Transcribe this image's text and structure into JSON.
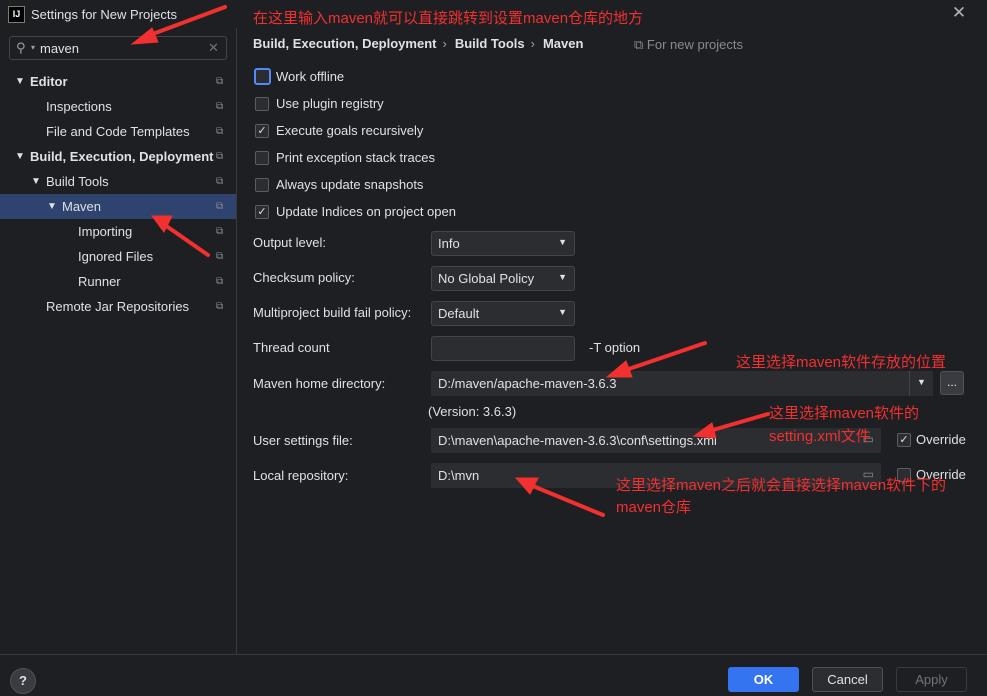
{
  "window": {
    "title": "Settings for New Projects",
    "logo": "IJ",
    "close_icon": "close-icon"
  },
  "search": {
    "value": "maven",
    "placeholder": ""
  },
  "sidebar": {
    "items": [
      {
        "label": "Editor",
        "expanded": true,
        "bold": true
      },
      {
        "label": "Inspections"
      },
      {
        "label": "File and Code Templates"
      },
      {
        "label": "Build, Execution, Deployment",
        "expanded": true,
        "bold": true
      },
      {
        "label": "Build Tools",
        "expanded": true
      },
      {
        "label": "Maven",
        "expanded": true,
        "selected": true
      },
      {
        "label": "Importing"
      },
      {
        "label": "Ignored Files"
      },
      {
        "label": "Runner"
      },
      {
        "label": "Remote Jar Repositories"
      }
    ]
  },
  "breadcrumb": {
    "items": [
      "Build, Execution, Deployment",
      "Build Tools",
      "Maven"
    ],
    "sep": "›",
    "scope": "For new projects"
  },
  "checkboxes": [
    {
      "label": "Work offline",
      "checked": false
    },
    {
      "label": "Use plugin registry",
      "checked": false
    },
    {
      "label": "Execute goals recursively",
      "checked": true
    },
    {
      "label": "Print exception stack traces",
      "checked": false
    },
    {
      "label": "Always update snapshots",
      "checked": false
    },
    {
      "label": "Update Indices on project open",
      "checked": true
    }
  ],
  "form": {
    "output_level": {
      "label": "Output level:",
      "value": "Info"
    },
    "checksum_policy": {
      "label": "Checksum policy:",
      "value": "No Global Policy"
    },
    "fail_policy": {
      "label": "Multiproject build fail policy:",
      "value": "Default"
    },
    "thread_count": {
      "label": "Thread count",
      "value": "",
      "hint": "-T option"
    },
    "maven_home": {
      "label": "Maven home directory:",
      "value": "D:/maven/apache-maven-3.6.3",
      "version": "(Version: 3.6.3)",
      "browse": "..."
    },
    "user_settings": {
      "label": "User settings file:",
      "value": "D:\\maven\\apache-maven-3.6.3\\conf\\settings.xml",
      "override_label": "Override",
      "override_checked": true
    },
    "local_repo": {
      "label": "Local repository:",
      "value": "D:\\mvn",
      "override_label": "Override",
      "override_checked": false
    }
  },
  "annotations": {
    "search_tip": "在这里输入maven就可以直接跳转到设置maven仓库的地方",
    "home_tip": "这里选择maven软件存放的位置",
    "settings_tip_1": "这里选择maven软件的",
    "settings_tip_2": "setting.xml文件",
    "repo_tip_1": "这里选择maven之后就会直接选择maven软件下的",
    "repo_tip_2": "maven仓库",
    "color": "#f23030"
  },
  "buttons": {
    "help": "?",
    "ok": "OK",
    "cancel": "Cancel",
    "apply": "Apply"
  },
  "colors": {
    "background": "#1e1f22",
    "selection": "#2e436e",
    "accent": "#3574f0"
  }
}
